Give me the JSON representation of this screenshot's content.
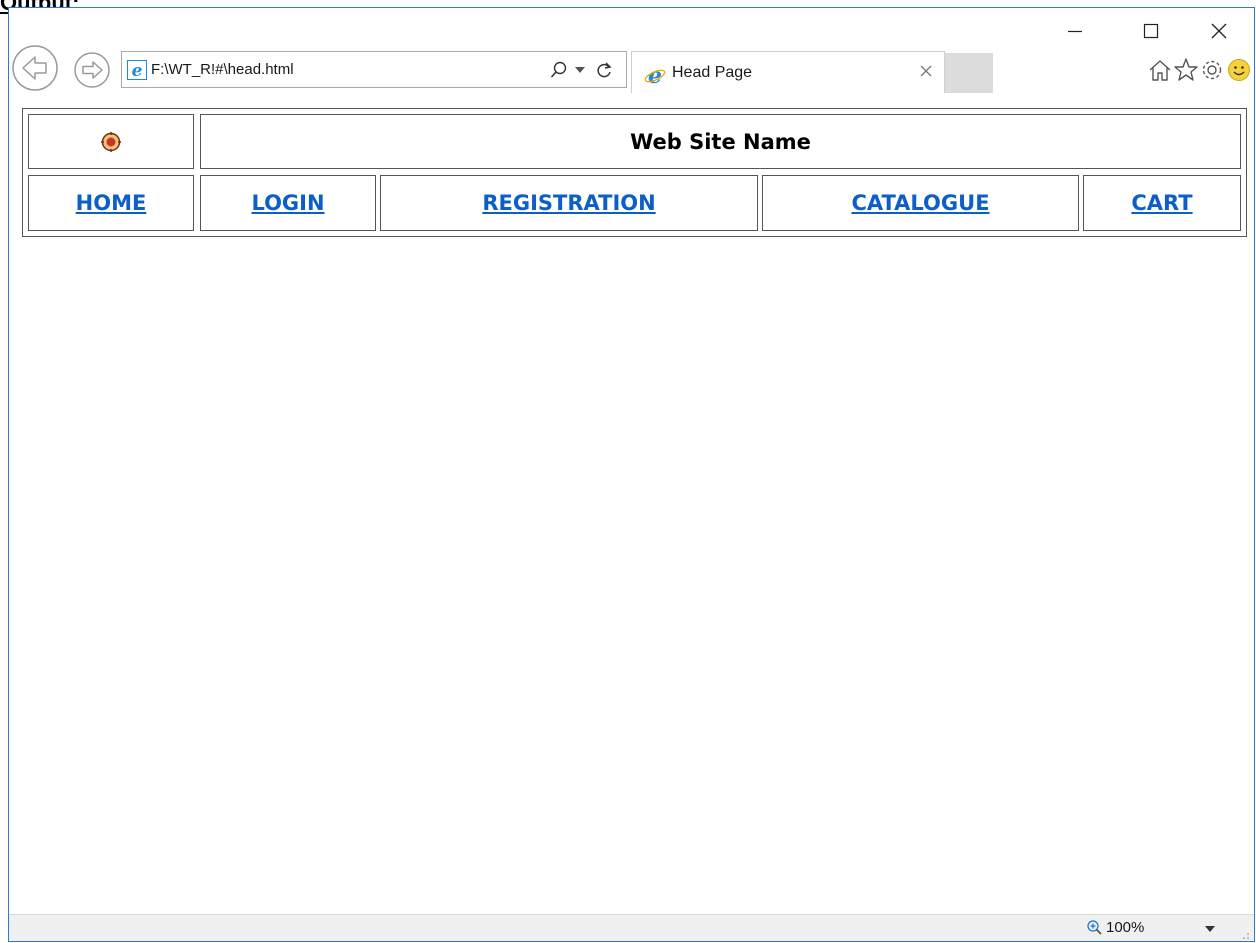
{
  "document": {
    "heading": "Output:"
  },
  "browser": {
    "address": "F:\\WT_R!#\\head.html",
    "tab_title": "Head Page",
    "zoom": "100%"
  },
  "page": {
    "site_name": "Web Site Name",
    "nav": [
      {
        "label": "HOME"
      },
      {
        "label": "LOGIN"
      },
      {
        "label": "REGISTRATION"
      },
      {
        "label": "CATALOGUE"
      },
      {
        "label": "CART"
      }
    ]
  },
  "icons": [
    "back-icon",
    "forward-icon",
    "ie-logo-icon",
    "search-icon",
    "refresh-icon",
    "close-icon",
    "home-icon",
    "favorites-icon",
    "settings-icon",
    "smiley-icon",
    "zoom-icon",
    "logo-icon"
  ],
  "colors": {
    "link": "#0c5fc9",
    "window_border": "#2b79d8",
    "ie_blue": "#1e88e5"
  }
}
